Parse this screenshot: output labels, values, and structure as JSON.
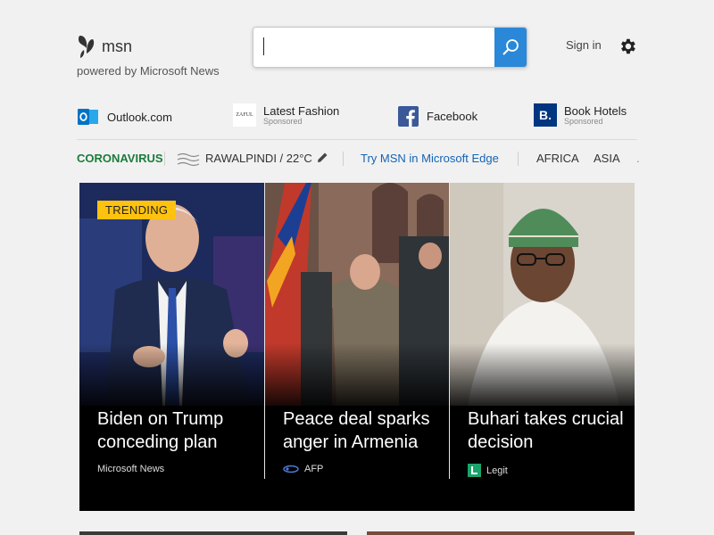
{
  "header": {
    "logo_text": "msn",
    "tagline": "powered by Microsoft News",
    "search": {
      "value": "",
      "placeholder": ""
    },
    "signin_label": "Sign in"
  },
  "quick_links": [
    {
      "label": "Outlook.com",
      "sub": "",
      "icon": "outlook-icon"
    },
    {
      "label": "Latest Fashion",
      "sub": "Sponsored",
      "icon": "zaful-icon",
      "icon_text": "ZAFUL"
    },
    {
      "label": "Facebook",
      "sub": "",
      "icon": "facebook-icon"
    },
    {
      "label": "Book Hotels",
      "sub": "Sponsored",
      "icon": "booking-icon",
      "icon_text": "B."
    }
  ],
  "nav": {
    "coronavirus": "CORONAVIRUS",
    "weather": "RAWALPINDI / 22°C",
    "edge": "Try MSN in Microsoft Edge",
    "regions": [
      "AFRICA",
      "ASIA"
    ]
  },
  "hero": {
    "trending_badge": "TRENDING",
    "cards": [
      {
        "title": "Biden on Trump conceding plan",
        "source": "Microsoft News",
        "source_icon": ""
      },
      {
        "title": "Peace deal sparks anger in Armenia",
        "source": "AFP",
        "source_icon": "afp-icon"
      },
      {
        "title": "Buhari takes crucial decision",
        "source": "Legit",
        "source_icon": "legit-icon"
      }
    ]
  },
  "colors": {
    "accent": "#2b88d8",
    "coronavirus": "#1b7c3a",
    "edge_link": "#1464b4",
    "trending": "#ffc20e"
  }
}
